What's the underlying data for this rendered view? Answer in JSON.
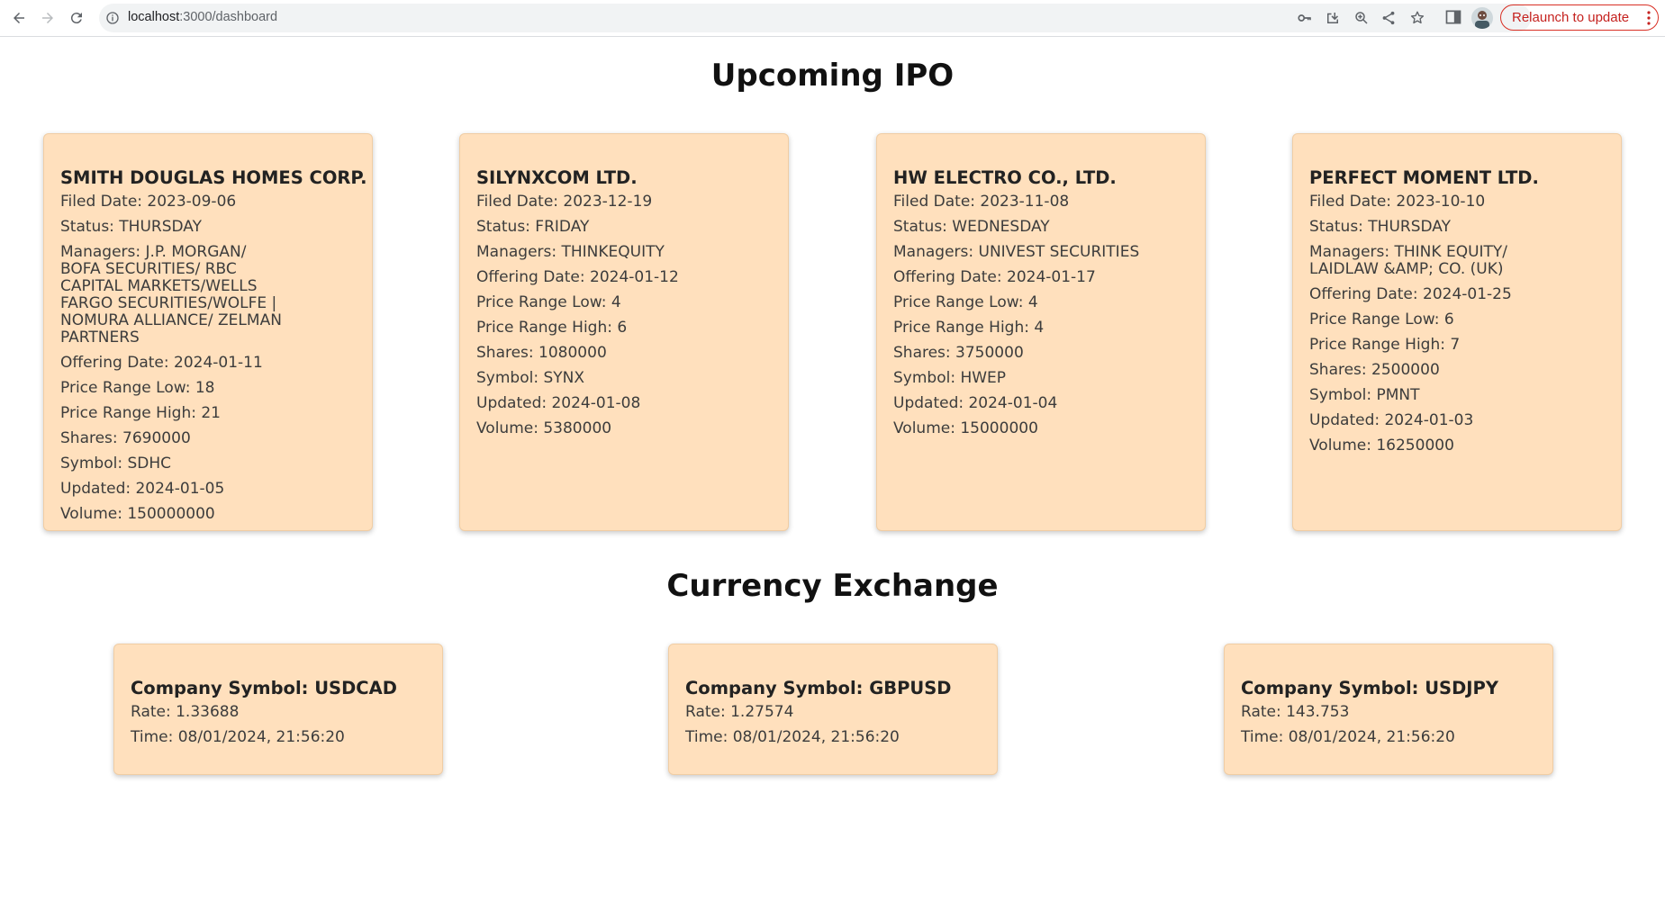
{
  "browser": {
    "url_host": "localhost",
    "url_path": ":3000/dashboard",
    "relaunch_label": "Relaunch to update"
  },
  "ipo": {
    "heading": "Upcoming IPO",
    "cards": [
      {
        "name": "SMITH DOUGLAS HOMES CORP.",
        "filed": "Filed Date: 2023-09-06",
        "status": "Status: THURSDAY",
        "managers": "Managers: J.P. MORGAN/ BOFA SECURITIES/ RBC CAPITAL MARKETS/WELLS FARGO SECURITIES/WOLFE | NOMURA ALLIANCE/ ZELMAN PARTNERS",
        "offering": "Offering Date: 2024-01-11",
        "low": "Price Range Low: 18",
        "high": "Price Range High: 21",
        "shares": "Shares: 7690000",
        "symbol": "Symbol: SDHC",
        "updated": "Updated: 2024-01-05",
        "volume": "Volume: 150000000"
      },
      {
        "name": "SILYNXCOM LTD.",
        "filed": "Filed Date: 2023-12-19",
        "status": "Status: FRIDAY",
        "managers": "Managers: THINKEQUITY",
        "offering": "Offering Date: 2024-01-12",
        "low": "Price Range Low: 4",
        "high": "Price Range High: 6",
        "shares": "Shares: 1080000",
        "symbol": "Symbol: SYNX",
        "updated": "Updated: 2024-01-08",
        "volume": "Volume: 5380000"
      },
      {
        "name": "HW ELECTRO CO., LTD.",
        "filed": "Filed Date: 2023-11-08",
        "status": "Status: WEDNESDAY",
        "managers": "Managers: UNIVEST SECURITIES",
        "offering": "Offering Date: 2024-01-17",
        "low": "Price Range Low: 4",
        "high": "Price Range High: 4",
        "shares": "Shares: 3750000",
        "symbol": "Symbol: HWEP",
        "updated": "Updated: 2024-01-04",
        "volume": "Volume: 15000000"
      },
      {
        "name": "PERFECT MOMENT LTD.",
        "filed": "Filed Date: 2023-10-10",
        "status": "Status: THURSDAY",
        "managers": "Managers: THINK EQUITY/ LAIDLAW &AMP; CO. (UK)",
        "offering": "Offering Date: 2024-01-25",
        "low": "Price Range Low: 6",
        "high": "Price Range High: 7",
        "shares": "Shares: 2500000",
        "symbol": "Symbol: PMNT",
        "updated": "Updated: 2024-01-03",
        "volume": "Volume: 16250000"
      }
    ]
  },
  "fx": {
    "heading": "Currency Exchange",
    "cards": [
      {
        "symbol": "Company Symbol: USDCAD",
        "rate": "Rate: 1.33688",
        "time": "Time: 08/01/2024, 21:56:20"
      },
      {
        "symbol": "Company Symbol: GBPUSD",
        "rate": "Rate: 1.27574",
        "time": "Time: 08/01/2024, 21:56:20"
      },
      {
        "symbol": "Company Symbol: USDJPY",
        "rate": "Rate: 143.753",
        "time": "Time: 08/01/2024, 21:56:20"
      }
    ]
  },
  "colors": {
    "card_bg": "#ffe0bd",
    "relaunch_red": "#d93025"
  }
}
